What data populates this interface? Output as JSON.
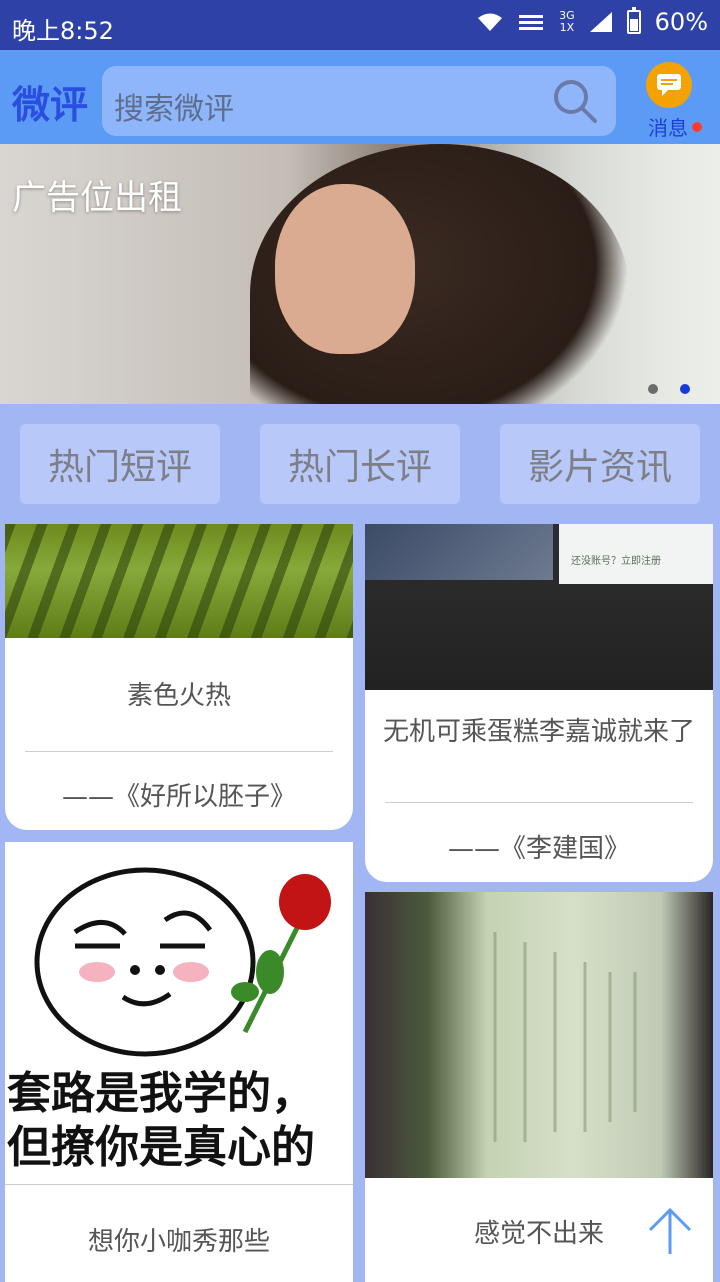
{
  "status_bar": {
    "time": "晚上8:52",
    "network_top": "3G",
    "network_bottom": "1X",
    "battery": "60%"
  },
  "header": {
    "brand": "微评",
    "search_placeholder": "搜索微评",
    "message_label": "消息",
    "accent_color": "#5b9bf6",
    "icons": [
      "search-icon",
      "chat-bubble-icon",
      "notification-dot"
    ]
  },
  "banner": {
    "caption": "广告位出租",
    "indicator_count": 2,
    "active_indicator": 2
  },
  "tabs": [
    {
      "label": "热门短评"
    },
    {
      "label": "热门长评"
    },
    {
      "label": "影片资讯"
    }
  ],
  "feed": [
    {
      "title": "素色火热",
      "author": "——《好所以胚子》"
    },
    {
      "title": "无机可乘蛋糕李嘉诚就来了",
      "author": "——《李建国》"
    },
    {
      "title": "想你小咖秀那些",
      "image_text": [
        "套路是我学的，",
        "但撩你是真心的"
      ]
    },
    {
      "title": "感觉不出来"
    }
  ],
  "screen_thumbnail_text": "还没账号？立即注册"
}
